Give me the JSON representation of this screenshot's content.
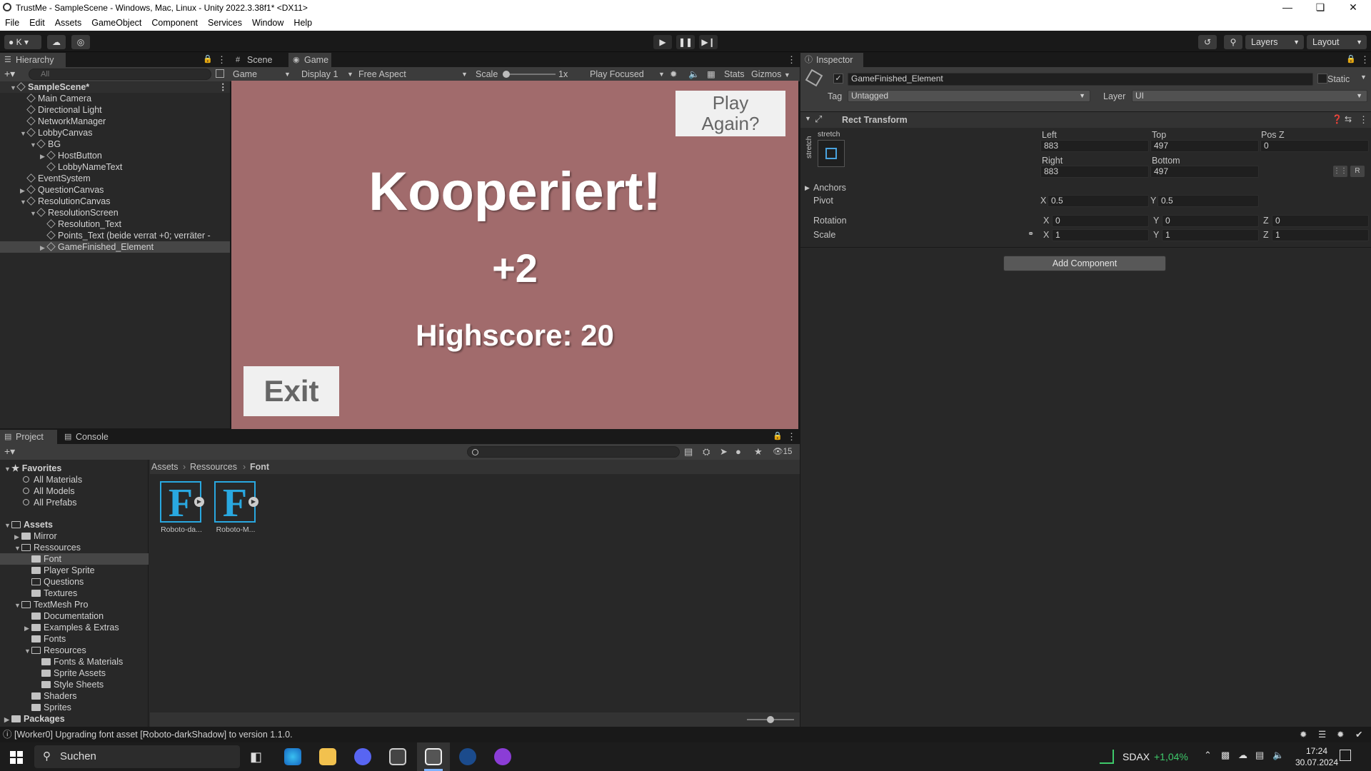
{
  "window": {
    "title": "TrustMe - SampleScene - Windows, Mac, Linux - Unity 2022.3.38f1* <DX11>"
  },
  "menu": [
    "File",
    "Edit",
    "Assets",
    "GameObject",
    "Component",
    "Services",
    "Window",
    "Help"
  ],
  "toolbar": {
    "account": "K",
    "layers": "Layers",
    "layout": "Layout"
  },
  "hierarchy": {
    "tab": "Hierarchy",
    "search_placeholder": "All",
    "items": [
      {
        "label": "SampleScene*",
        "indent": 0,
        "type": "scene"
      },
      {
        "label": "Main Camera",
        "indent": 1
      },
      {
        "label": "Directional Light",
        "indent": 1
      },
      {
        "label": "NetworkManager",
        "indent": 1
      },
      {
        "label": "LobbyCanvas",
        "indent": 1,
        "expanded": true
      },
      {
        "label": "BG",
        "indent": 2,
        "expanded": true
      },
      {
        "label": "HostButton",
        "indent": 3,
        "collapsed": true
      },
      {
        "label": "LobbyNameText",
        "indent": 3
      },
      {
        "label": "EventSystem",
        "indent": 1
      },
      {
        "label": "QuestionCanvas",
        "indent": 1,
        "collapsed": true
      },
      {
        "label": "ResolutionCanvas",
        "indent": 1,
        "expanded": true
      },
      {
        "label": "ResolutionScreen",
        "indent": 2,
        "expanded": true
      },
      {
        "label": "Resolution_Text",
        "indent": 3
      },
      {
        "label": "Points_Text (beide verrat +0; verräter -",
        "indent": 3
      },
      {
        "label": "GameFinished_Element",
        "indent": 3,
        "collapsed": true,
        "selected": true
      }
    ]
  },
  "gametabs": {
    "scene": "Scene",
    "game": "Game"
  },
  "gamebar": {
    "mode": "Game",
    "display": "Display 1",
    "aspect": "Free Aspect",
    "scale_label": "Scale",
    "scale_value": "1x",
    "play_focused": "Play Focused",
    "stats": "Stats",
    "gizmos": "Gizmos"
  },
  "game": {
    "title": "Kooperiert!",
    "points": "+2",
    "highscore": "Highscore: 20",
    "play_again_1": "Play",
    "play_again_2": "Again?",
    "exit": "Exit"
  },
  "inspector": {
    "tab": "Inspector",
    "object_name": "GameFinished_Element",
    "static_label": "Static",
    "tag_label": "Tag",
    "tag_value": "Untagged",
    "layer_label": "Layer",
    "layer_value": "UI",
    "component": "Rect Transform",
    "stretch": "stretch",
    "left_label": "Left",
    "left": "883",
    "top_label": "Top",
    "top": "497",
    "posz_label": "Pos Z",
    "posz": "0",
    "right_label": "Right",
    "right": "883",
    "bottom_label": "Bottom",
    "bottom": "497",
    "anchors": "Anchors",
    "pivot_label": "Pivot",
    "pivot_x": "0.5",
    "pivot_y": "0.5",
    "rotation_label": "Rotation",
    "rot_x": "0",
    "rot_y": "0",
    "rot_z": "0",
    "scale_label": "Scale",
    "scale_x": "1",
    "scale_y": "1",
    "scale_z": "1",
    "x": "X",
    "y": "Y",
    "z": "Z",
    "r": "R",
    "add_component": "Add Component"
  },
  "project": {
    "tab_project": "Project",
    "tab_console": "Console",
    "count": "15",
    "favorites": {
      "label": "Favorites",
      "items": [
        "All Materials",
        "All Models",
        "All Prefabs"
      ]
    },
    "tree": [
      {
        "label": "Assets",
        "indent": 0,
        "bold": true,
        "open": true
      },
      {
        "label": "Mirror",
        "indent": 1,
        "collapsed": true
      },
      {
        "label": "Ressources",
        "indent": 1,
        "open": true
      },
      {
        "label": "Font",
        "indent": 2,
        "selected": true
      },
      {
        "label": "Player Sprite",
        "indent": 2
      },
      {
        "label": "Questions",
        "indent": 2,
        "empty": true
      },
      {
        "label": "Textures",
        "indent": 2
      },
      {
        "label": "TextMesh Pro",
        "indent": 1,
        "open": true
      },
      {
        "label": "Documentation",
        "indent": 2
      },
      {
        "label": "Examples & Extras",
        "indent": 2,
        "collapsed": true
      },
      {
        "label": "Fonts",
        "indent": 2
      },
      {
        "label": "Resources",
        "indent": 2,
        "open": true
      },
      {
        "label": "Fonts & Materials",
        "indent": 3
      },
      {
        "label": "Sprite Assets",
        "indent": 3
      },
      {
        "label": "Style Sheets",
        "indent": 3
      },
      {
        "label": "Shaders",
        "indent": 2
      },
      {
        "label": "Sprites",
        "indent": 2
      },
      {
        "label": "Packages",
        "indent": 0,
        "bold": true,
        "collapsed": true
      }
    ],
    "breadcrumb": [
      "Assets",
      "Ressources",
      "Font"
    ],
    "assets": [
      {
        "label": "Roboto-da...",
        "glyph": "F"
      },
      {
        "label": "Roboto-M...",
        "glyph": "F"
      }
    ]
  },
  "status": {
    "message": "[Worker0] Upgrading font asset [Roboto-darkShadow] to version 1.1.0."
  },
  "taskbar": {
    "search": "Suchen",
    "stock": "SDAX",
    "stock_change": "+1,04%",
    "time": "17:24",
    "date": "30.07.2024",
    "colors": {
      "stock_up": "#3ec96a"
    }
  }
}
